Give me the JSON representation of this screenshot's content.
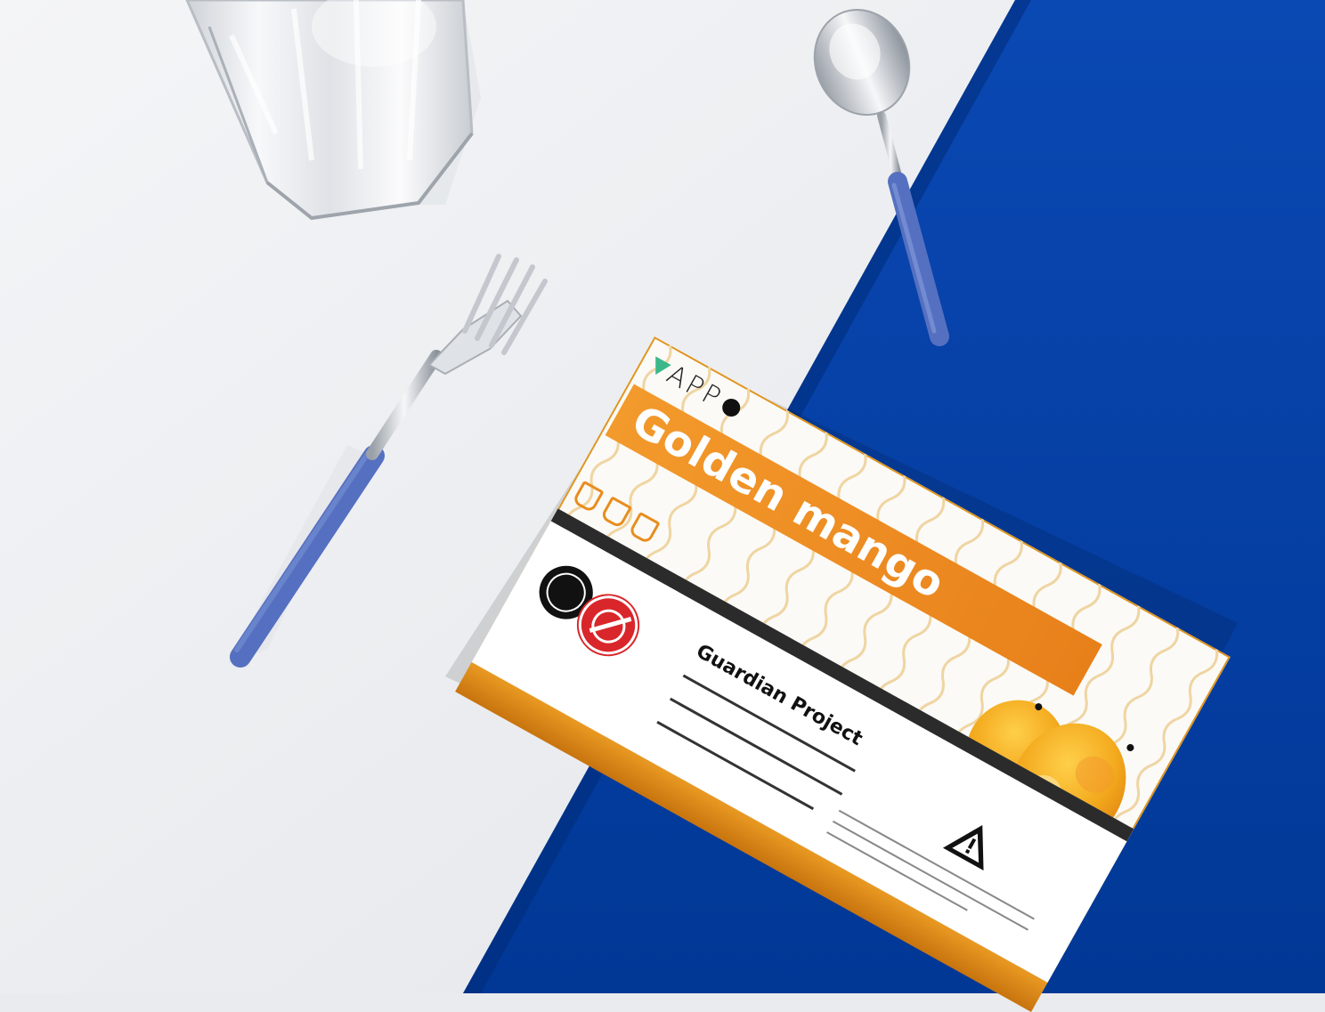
{
  "package": {
    "brand": "APP",
    "flavor": "Golden mango",
    "warning_title": "Guardian Project",
    "colors": {
      "tabletop_blue": "#013da3",
      "tabletop_white": "#eef0f3",
      "package_orange": "#ef8f22",
      "mango_yellow": "#f5b523",
      "utensil_handle_blue": "#5570c0"
    },
    "icons": [
      "logo-triangle-icon",
      "pod-icon",
      "mango-illustration",
      "no-minors-badge-icon",
      "age-18-badge-icon",
      "warning-triangle-icon"
    ],
    "pod_count_icons": 3
  },
  "scene": {
    "objects": [
      "drinking-glass",
      "fork",
      "spoon",
      "package-box"
    ]
  }
}
